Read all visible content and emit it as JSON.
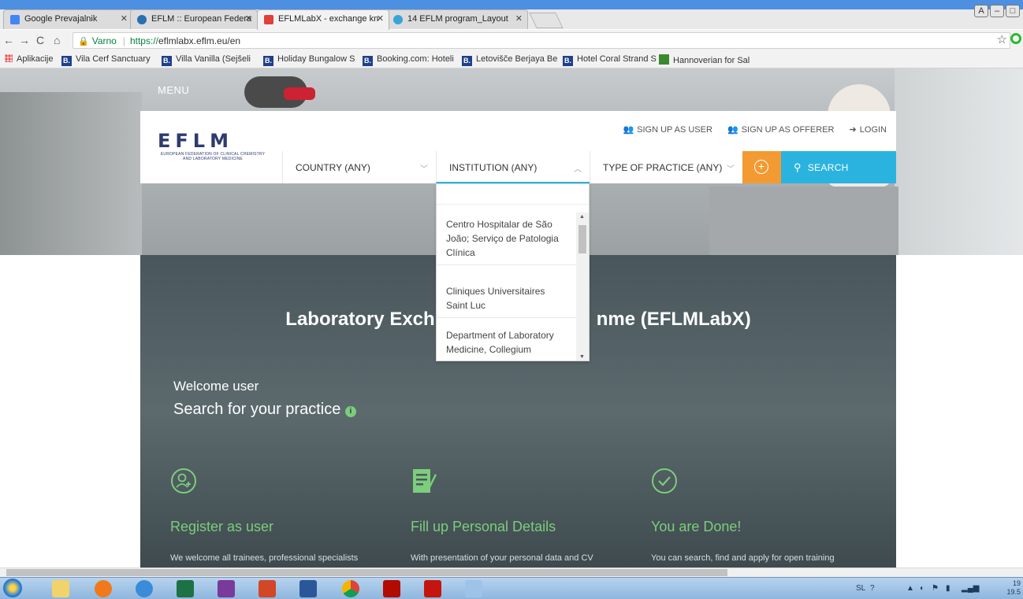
{
  "browser": {
    "tabs": [
      {
        "label": "Google Prevajalnik",
        "favicon_color": "#4285f4",
        "active": false
      },
      {
        "label": "EFLM :: European Federat",
        "favicon_color": "#2a6fb0",
        "active": false
      },
      {
        "label": "EFLMLabX - exchange kn",
        "favicon_color": "#e0403a",
        "active": true
      },
      {
        "label": "14 EFLM program_Layout",
        "favicon_color": "#3aa3d8",
        "active": false
      }
    ],
    "window_buttons": [
      "A",
      "–",
      "□"
    ],
    "secure_label": "Varno",
    "url_scheme": "https://",
    "url_rest": "eflmlabx.eflm.eu/en"
  },
  "bookmarks": [
    {
      "label": "Aplikacije",
      "icon": "apps-icon"
    },
    {
      "label": "Vila Cerf Sanctuary",
      "icon": "B."
    },
    {
      "label": "Villa Vanilla (Sejšeli",
      "icon": "B."
    },
    {
      "label": "Holiday Bungalow S",
      "icon": "B."
    },
    {
      "label": "Booking.com: Hoteli",
      "icon": "B."
    },
    {
      "label": "Letovišče Berjaya Be",
      "icon": "B."
    },
    {
      "label": "Hotel Coral Strand S",
      "icon": "B."
    },
    {
      "label": "Hannoverian for Sal",
      "icon": "horse-icon"
    }
  ],
  "site": {
    "menu_label": "MENU",
    "logo_word": "EFLM",
    "logo_tagline_1": "EUROPEAN FEDERATION OF CLINICAL CHEMISTRY",
    "logo_tagline_2": "AND LABORATORY MEDICINE",
    "links": {
      "signup_user": "SIGN UP AS USER",
      "signup_offerer": "SIGN UP AS OFFERER",
      "login": "LOGIN"
    },
    "filters": {
      "country": "COUNTRY (ANY)",
      "institution": "INSTITUTION (ANY)",
      "practice": "TYPE OF PRACTICE (ANY)",
      "search": "SEARCH"
    },
    "institution_options": [
      "Centro Hospitalar de São João; Serviço de Patologia Clínica",
      "Cliniques Universitaires Saint Luc",
      "Department of Laboratory Medicine, Collegium"
    ],
    "banner": {
      "title_left": "Laboratory Exch",
      "title_right": "nme (EFLMLabX)",
      "welcome": "Welcome user",
      "search_heading": "Search for your practice",
      "info_glyph": "i"
    },
    "steps": [
      {
        "icon": "user-add-icon",
        "title": "Register as user",
        "desc": "We welcome all trainees, professional specialists"
      },
      {
        "icon": "form-edit-icon",
        "title": "Fill up Personal Details",
        "desc": "With presentation of your personal data and CV"
      },
      {
        "icon": "check-circle-icon",
        "title": "You are Done!",
        "desc": "You can search, find and apply for open training"
      }
    ]
  },
  "taskbar": {
    "tray_lang": "SL",
    "clock_top": "19",
    "clock_bottom": "19.5"
  },
  "colors": {
    "accent_green": "#7ccd7c",
    "search_blue": "#2bb3e0",
    "plus_orange": "#f39a32",
    "banner_dark": "#4b595d",
    "logo_navy": "#2d3b6e"
  }
}
